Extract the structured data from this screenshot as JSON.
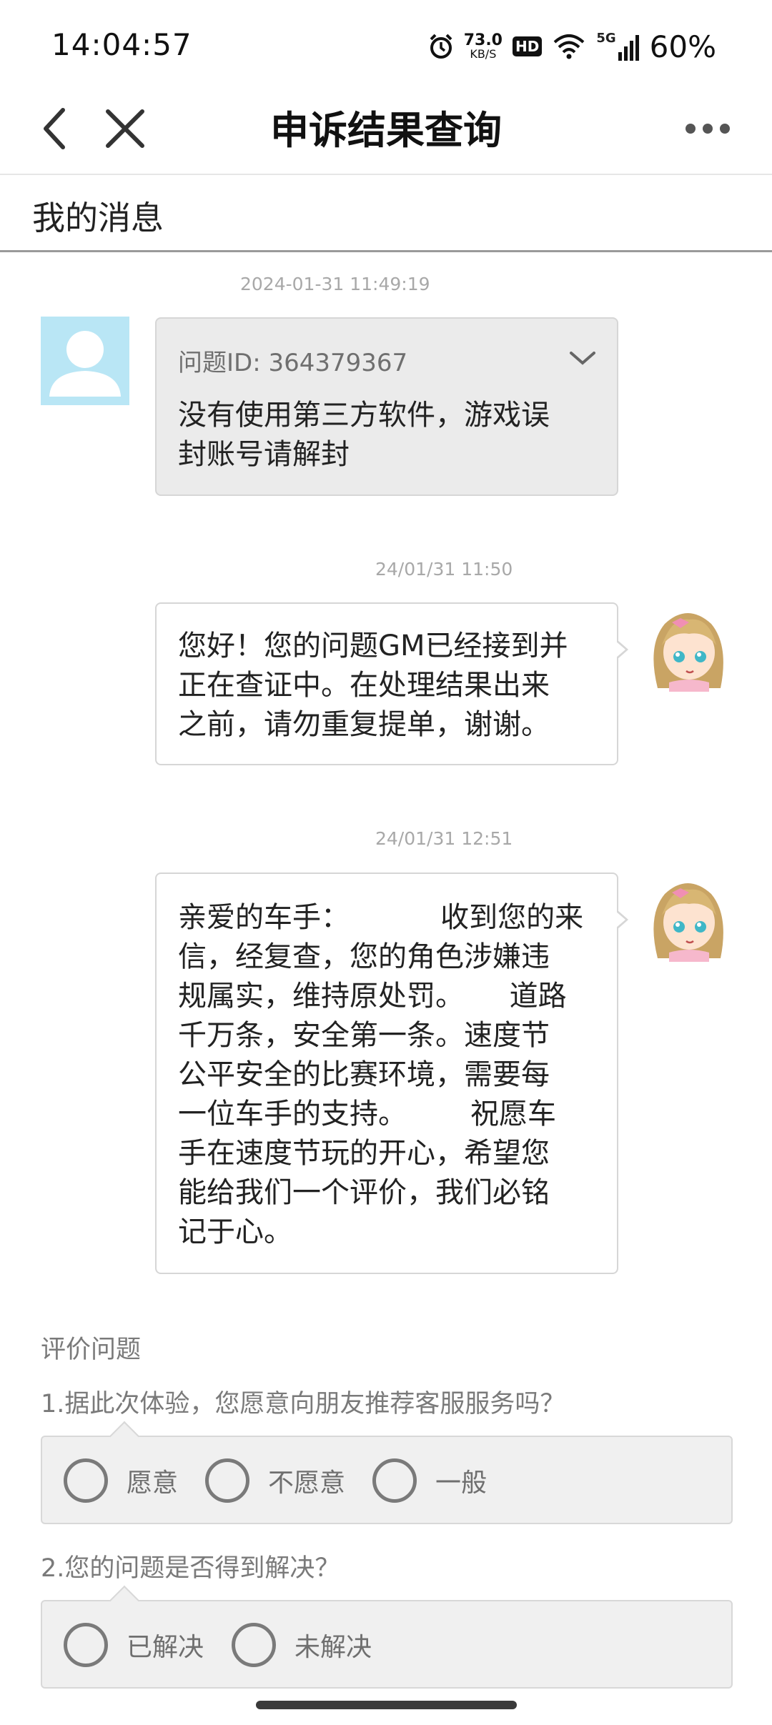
{
  "status_bar": {
    "time": "14:04:57",
    "net_speed_value": "73.0",
    "net_speed_unit": "KB/S",
    "hd_label": "HD",
    "network_label": "5G",
    "battery": "60%"
  },
  "nav": {
    "title": "申诉结果查询"
  },
  "section": {
    "title": "我的消息"
  },
  "messages": [
    {
      "timestamp": "2024-01-31 11:49:19",
      "sender": "user",
      "question_id": "问题ID: 364379367",
      "text": "没有使用第三方软件，游戏误\n封账号请解封"
    },
    {
      "timestamp": "24/01/31 11:50",
      "sender": "gm",
      "text": "您好！您的问题GM已经接到并\n正在查证中。在处理结果出来\n之前，请勿重复提单，谢谢。"
    },
    {
      "timestamp": "24/01/31 12:51",
      "sender": "gm",
      "text": "亲爱的车手：          收到您的来\n信，经复查，您的角色涉嫌违\n规属实，维持原处罚。     道路\n千万条，安全第一条。速度节\n公平安全的比赛环境，需要每\n一位车手的支持。       祝愿车\n手在速度节玩的开心，希望您\n能给我们一个评价，我们必铭\n记于心。"
    }
  ],
  "evaluation": {
    "title": "评价问题",
    "questions": [
      {
        "text": "1.据此次体验，您愿意向朋友推荐客服服务吗？",
        "options": [
          "愿意",
          "不愿意",
          "一般"
        ]
      },
      {
        "text": "2.您的问题是否得到解决？",
        "options": [
          "已解决",
          "未解决"
        ]
      }
    ]
  },
  "colors": {
    "user_avatar_bg": "#b9e6f5",
    "user_bubble_bg": "#ebebeb",
    "option_box_bg": "#f0f0f0"
  }
}
